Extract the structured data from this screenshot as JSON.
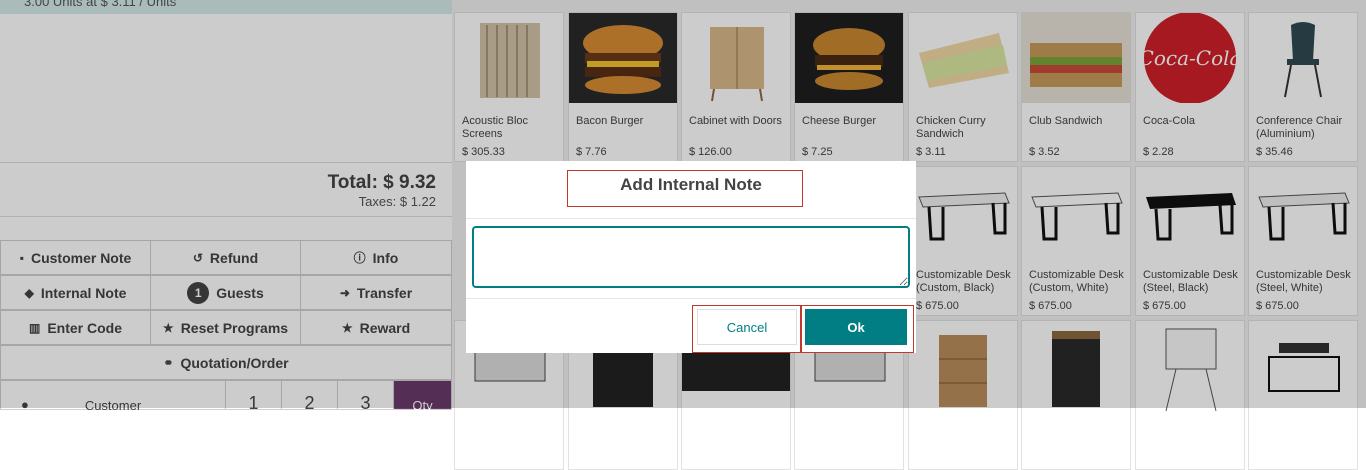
{
  "order": {
    "line_text": "3.00 Units at $ 3.11 / Units",
    "total": "Total: $ 9.32",
    "taxes": "Taxes: $ 1.22"
  },
  "controls": [
    {
      "label": "Customer Note",
      "icon": "note-icon"
    },
    {
      "label": "Refund",
      "icon": "undo-icon"
    },
    {
      "label": "Info",
      "icon": "info-icon"
    },
    {
      "label": "Internal Note",
      "icon": "tag-icon"
    },
    {
      "label": "Guests",
      "badge": "1"
    },
    {
      "label": "Transfer",
      "icon": "arrow-right-icon"
    },
    {
      "label": "Enter Code",
      "icon": "barcode-icon"
    },
    {
      "label": "Reset Programs",
      "icon": "star-icon"
    },
    {
      "label": "Reward",
      "icon": "star-icon"
    },
    {
      "label": "Quotation/Order",
      "icon": "link-icon"
    }
  ],
  "numpad": {
    "customer": "Customer",
    "keys": [
      "1",
      "2",
      "3"
    ],
    "qty": "Qty"
  },
  "products": [
    {
      "name": "Acoustic Bloc Screens",
      "price": "$ 305.33"
    },
    {
      "name": "Bacon Burger",
      "price": "$ 7.76"
    },
    {
      "name": "Cabinet with Doors",
      "price": "$ 126.00"
    },
    {
      "name": "Cheese Burger",
      "price": "$ 7.25"
    },
    {
      "name": "Chicken Curry Sandwich",
      "price": "$ 3.11"
    },
    {
      "name": "Club Sandwich",
      "price": "$ 3.52"
    },
    {
      "name": "Coca-Cola",
      "price": "$ 2.28"
    },
    {
      "name": "Conference Chair (Aluminium)",
      "price": "$ 35.46"
    },
    {
      "name": "Customizable Desk (Custom, Black)",
      "price": "$ 675.00"
    },
    {
      "name": "Customizable Desk (Custom, White)",
      "price": "$ 675.00"
    },
    {
      "name": "Customizable Desk (Steel, Black)",
      "price": "$ 675.00"
    },
    {
      "name": "Customizable Desk (Steel, White)",
      "price": "$ 675.00"
    }
  ],
  "dialog": {
    "title": "Add Internal Note",
    "note_value": "",
    "cancel": "Cancel",
    "ok": "Ok"
  },
  "colors": {
    "accent": "#017e84",
    "highlight": "#c0392b",
    "qty_bg": "#6b3a6b"
  }
}
